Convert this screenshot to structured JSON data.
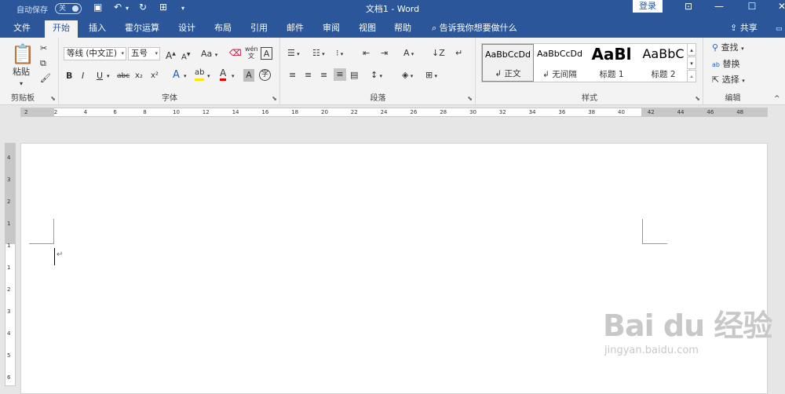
{
  "title_bar": {
    "autosave_label": "自动保存",
    "autosave_state": "关",
    "doc_title": "文档1 - Word",
    "login_label": "登录"
  },
  "tabs": [
    {
      "label": "文件"
    },
    {
      "label": "开始"
    },
    {
      "label": "插入"
    },
    {
      "label": "霍尔运算"
    },
    {
      "label": "设计"
    },
    {
      "label": "布局"
    },
    {
      "label": "引用"
    },
    {
      "label": "邮件"
    },
    {
      "label": "审阅"
    },
    {
      "label": "视图"
    },
    {
      "label": "帮助"
    }
  ],
  "tell_me": "告诉我你想要做什么",
  "share_label": "共享",
  "clipboard": {
    "paste_label": "粘贴",
    "group_label": "剪贴板"
  },
  "font": {
    "font_name": "等线 (中文正)",
    "font_size": "五号",
    "change_case": "Aa",
    "group_label": "字体",
    "bold": "B",
    "italic": "I",
    "underline": "U",
    "strike": "abc",
    "sub": "x₂",
    "sup": "x²",
    "grow": "A",
    "shrink": "A",
    "phonetic": "wén",
    "text_effect": "A",
    "highlight": "ab",
    "font_color": "A",
    "char_shading": "A",
    "enclose": "字"
  },
  "paragraph": {
    "group_label": "段落"
  },
  "styles": {
    "group_label": "样式",
    "items": [
      {
        "preview": "AaBbCcDd",
        "name": "↲ 正文"
      },
      {
        "preview": "AaBbCcDd",
        "name": "↲ 无间隔"
      },
      {
        "preview": "AaBl",
        "name": "标题 1"
      },
      {
        "preview": "AaBbC",
        "name": "标题 2"
      }
    ]
  },
  "editing": {
    "group_label": "编辑",
    "find": "查找",
    "replace": "替换",
    "select": "选择"
  },
  "ruler": {
    "h_numbers": [
      "2",
      "2",
      "4",
      "6",
      "8",
      "10",
      "12",
      "14",
      "16",
      "18",
      "20",
      "22",
      "24",
      "26",
      "28",
      "30",
      "32",
      "34",
      "36",
      "38",
      "40",
      "42",
      "44",
      "46",
      "48"
    ],
    "v_numbers": [
      "4",
      "3",
      "2",
      "1",
      "1",
      "1",
      "2",
      "3",
      "4",
      "5",
      "6"
    ]
  },
  "document": {
    "para_mark": "↵"
  },
  "watermark": {
    "big": "Bai du 经验",
    "small": "jingyan.baidu.com"
  }
}
